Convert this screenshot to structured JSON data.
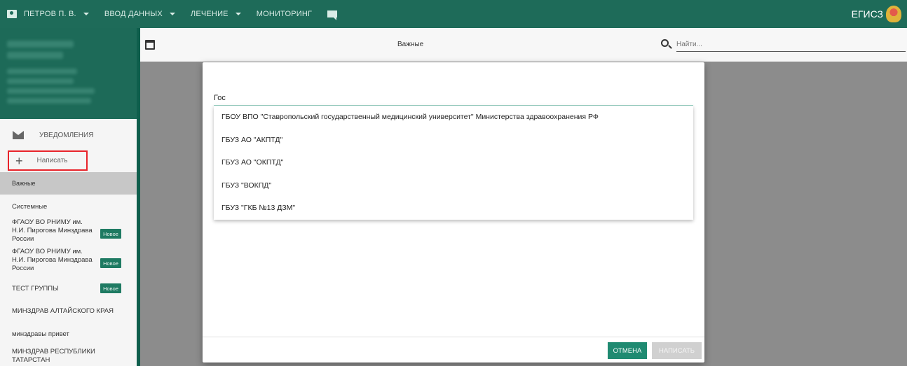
{
  "topbar": {
    "user_name": "ПЕТРОВ П. В.",
    "menu": [
      "ВВОД ДАННЫХ",
      "ЛЕЧЕНИЕ",
      "МОНИТОРИНГ"
    ],
    "brand": "ЕГИСЗ",
    "colors": {
      "primary": "#1e6b59",
      "accent": "#1f8a71"
    }
  },
  "sidebar": {
    "notifications_label": "УВЕДОМЛЕНИЯ",
    "write_label": "Написать",
    "important_label": "Важные",
    "system_label": "Системные",
    "groups": [
      {
        "name": "ФГАОУ ВО РНИМУ им. Н.И. Пирогова Минздрава России",
        "badge": "Новое"
      },
      {
        "name": "ФГАОУ ВО РНИМУ им. Н.И. Пирогова Минздрава России",
        "badge": "Новое"
      },
      {
        "name": "ТЕСТ ГРУППЫ",
        "badge": "Новое"
      },
      {
        "name": "МИНЗДРАВ АЛТАЙСКОГО КРАЯ",
        "badge": ""
      },
      {
        "name": "минздравы привет",
        "badge": ""
      },
      {
        "name": "МИНЗДРАВ РЕСПУБЛИКИ ТАТАРСТАН",
        "badge": ""
      }
    ]
  },
  "content": {
    "header_title": "Важные",
    "search_placeholder": "Найти..."
  },
  "modal": {
    "input_value": "Гос",
    "suggestions": [
      "ГБОУ ВПО \"Ставропольский государственный медицинский университет\" Министерства здравоохранения РФ",
      "ГБУЗ АО \"АКПТД\"",
      "ГБУЗ АО \"ОКПТД\"",
      "ГБУЗ \"ВОКПД\"",
      "ГБУЗ \"ГКБ №13 ДЗМ\""
    ],
    "cancel_label": "ОТМЕНА",
    "write_label": "НАПИСАТЬ"
  }
}
